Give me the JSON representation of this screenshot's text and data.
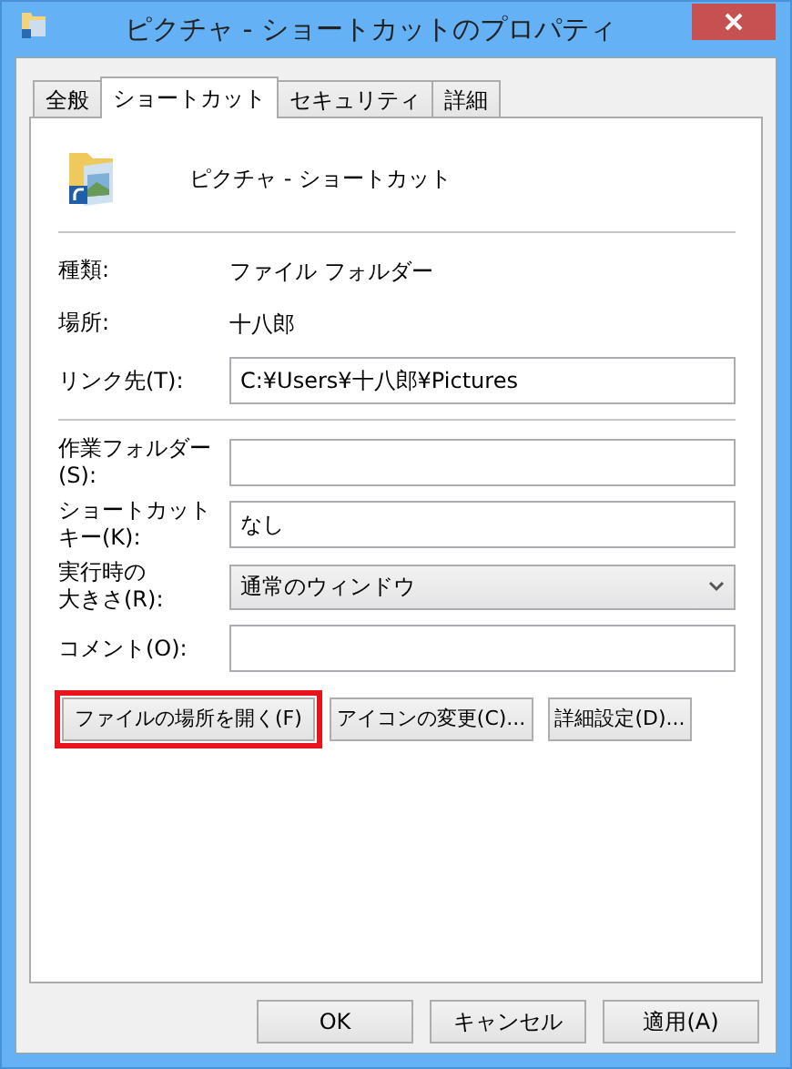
{
  "window": {
    "title": "ピクチャ - ショートカットのプロパティ"
  },
  "tabs": [
    {
      "label": "全般",
      "selected": false
    },
    {
      "label": "ショートカット",
      "selected": true
    },
    {
      "label": "セキュリティ",
      "selected": false
    },
    {
      "label": "詳細",
      "selected": false
    }
  ],
  "header": {
    "name": "ピクチャ - ショートカット"
  },
  "info": [
    {
      "label": "種類:",
      "value": "ファイル フォルダー"
    },
    {
      "label": "場所:",
      "value": "十八郎"
    }
  ],
  "link": {
    "label": "リンク先(T):",
    "value": "C:¥Users¥十八郎¥Pictures"
  },
  "fields": [
    {
      "kind": "text",
      "label_lines": [
        "作業フォルダー",
        "(S):"
      ]
    },
    {
      "kind": "text",
      "label_lines": [
        "ショートカット",
        "キー(K):"
      ],
      "value": "なし"
    },
    {
      "kind": "select",
      "label_lines": [
        "実行時の",
        "大きさ(R):"
      ],
      "value": "通常のウィンドウ"
    },
    {
      "kind": "text",
      "label_lines": [
        "コメント(O):"
      ]
    }
  ],
  "action_buttons": [
    {
      "label": "ファイルの場所を開く(F)",
      "highlighted": true
    },
    {
      "label": "アイコンの変更(C)...",
      "highlighted": false
    },
    {
      "label": "詳細設定(D)...",
      "highlighted": false
    }
  ],
  "dialog_buttons": [
    "OK",
    "キャンセル",
    "適用(A)"
  ]
}
